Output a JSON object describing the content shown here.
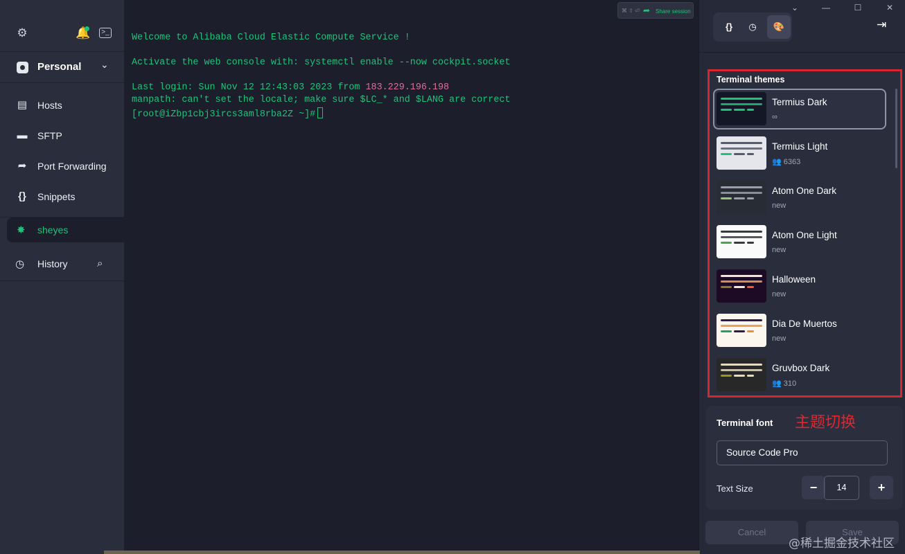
{
  "colors": {
    "accent": "#21c17a",
    "annotation": "#d6262f",
    "ip": "#e06c9a"
  },
  "sidebar": {
    "vault": {
      "label": "Personal"
    },
    "nav": [
      {
        "label": "Hosts",
        "icon": "hosts-icon"
      },
      {
        "label": "SFTP",
        "icon": "folder-icon"
      },
      {
        "label": "Port Forwarding",
        "icon": "arrow-forward-icon"
      },
      {
        "label": "Snippets",
        "icon": "braces-icon"
      }
    ],
    "active_host": {
      "label": "sheyes"
    },
    "history": {
      "label": "History"
    }
  },
  "terminal": {
    "lines": {
      "welcome": "Welcome to Alibaba Cloud Elastic Compute Service !",
      "activate": "Activate the web console with: systemctl enable --now cockpit.socket",
      "last_login_prefix": "Last login: Sun Nov 12 12:43:03 2023 from ",
      "last_login_ip": "183.229.196.198",
      "manpath": "manpath: can't set the locale; make sure $LC_* and $LANG are correct",
      "prompt": "[root@iZbp1cbj3ircs3aml8rba2Z ~]#"
    },
    "share_button": {
      "shortcut": "⌘ ⇧ ⏎",
      "label": "Share session"
    }
  },
  "panel": {
    "themes": {
      "title": "Terminal themes",
      "items": [
        {
          "name": "Termius Dark",
          "meta": "∞",
          "bg": "#141826",
          "top": "#21c17a",
          "mid": "#21c17a",
          "dots": [
            "#21c17a",
            "#21c17a",
            "#21c17a"
          ],
          "selected": true
        },
        {
          "name": "Termius Light",
          "meta": "6363",
          "users": true,
          "bg": "#e4e6ec",
          "top": "#555a6d",
          "mid": "#555a6d",
          "dots": [
            "#21c17a",
            "#555a6d",
            "#555a6d"
          ]
        },
        {
          "name": "Atom One Dark",
          "meta": "new",
          "bg": "#282c34",
          "top": "#9aa0ab",
          "mid": "#9aa0ab",
          "dots": [
            "#98c379",
            "#9aa0ab",
            "#9aa0ab"
          ]
        },
        {
          "name": "Atom One Light",
          "meta": "new",
          "bg": "#fafafa",
          "top": "#383a42",
          "mid": "#383a42",
          "dots": [
            "#50a14f",
            "#383a42",
            "#383a42"
          ]
        },
        {
          "name": "Halloween",
          "meta": "new",
          "bg": "#1d0a24",
          "top": "#f2e6d5",
          "mid": "#f2a65a",
          "dots": [
            "#8a7a30",
            "#f2e6d5",
            "#f25a2a"
          ]
        },
        {
          "name": "Dia De Muertos",
          "meta": "new",
          "bg": "#fbf6ee",
          "top": "#2d1a4f",
          "mid": "#e8903a",
          "dots": [
            "#21a06a",
            "#2d1a4f",
            "#e8903a"
          ]
        },
        {
          "name": "Gruvbox Dark",
          "meta": "310",
          "users": true,
          "bg": "#282828",
          "top": "#ebdbb2",
          "mid": "#ebdbb2",
          "dots": [
            "#98971a",
            "#ebdbb2",
            "#ebdbb2"
          ]
        }
      ]
    },
    "font": {
      "title": "Terminal font",
      "annotation": "主题切换",
      "value": "Source Code Pro",
      "size_label": "Text Size",
      "size_value": "14",
      "minus": "−",
      "plus": "+"
    },
    "footer": {
      "cancel": "Cancel",
      "save": "Save"
    }
  },
  "watermark": "@稀土掘金技术社区"
}
